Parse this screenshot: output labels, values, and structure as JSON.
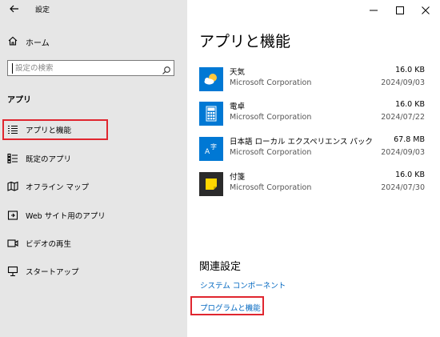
{
  "window": {
    "title": "設定",
    "back_icon": "back-arrow-icon",
    "controls": [
      "minimize-icon",
      "maximize-icon",
      "close-icon"
    ]
  },
  "sidebar": {
    "home_label": "ホーム",
    "search_placeholder": "設定の検索",
    "section_title": "アプリ",
    "items": [
      {
        "label": "アプリと機能",
        "icon": "apps-list-icon",
        "selected": true
      },
      {
        "label": "既定のアプリ",
        "icon": "default-apps-icon",
        "selected": false
      },
      {
        "label": "オフライン マップ",
        "icon": "offline-map-icon",
        "selected": false
      },
      {
        "label": "Web サイト用のアプリ",
        "icon": "web-apps-icon",
        "selected": false
      },
      {
        "label": "ビデオの再生",
        "icon": "video-icon",
        "selected": false
      },
      {
        "label": "スタートアップ",
        "icon": "startup-icon",
        "selected": false
      }
    ]
  },
  "main": {
    "title": "アプリと機能",
    "apps": [
      {
        "name": "天気",
        "publisher": "Microsoft Corporation",
        "size": "16.0 KB",
        "date": "2024/09/03",
        "icon": "weather-icon"
      },
      {
        "name": "電卓",
        "publisher": "Microsoft Corporation",
        "size": "16.0 KB",
        "date": "2024/07/22",
        "icon": "calculator-icon"
      },
      {
        "name": "日本語 ローカル エクスペリエンス パック",
        "publisher": "Microsoft Corporation",
        "size": "67.8 MB",
        "date": "2024/09/03",
        "icon": "language-pack-icon"
      },
      {
        "name": "付箋",
        "publisher": "Microsoft Corporation",
        "size": "16.0 KB",
        "date": "2024/07/30",
        "icon": "sticky-notes-icon"
      }
    ],
    "related": {
      "title": "関連設定",
      "links": [
        "システム コンポーネント",
        "プログラムと機能"
      ]
    }
  },
  "colors": {
    "sidebar_bg": "#e6e6e6",
    "accent": "#0078d4",
    "link": "#0067c0",
    "highlight_box": "#e0262f"
  }
}
